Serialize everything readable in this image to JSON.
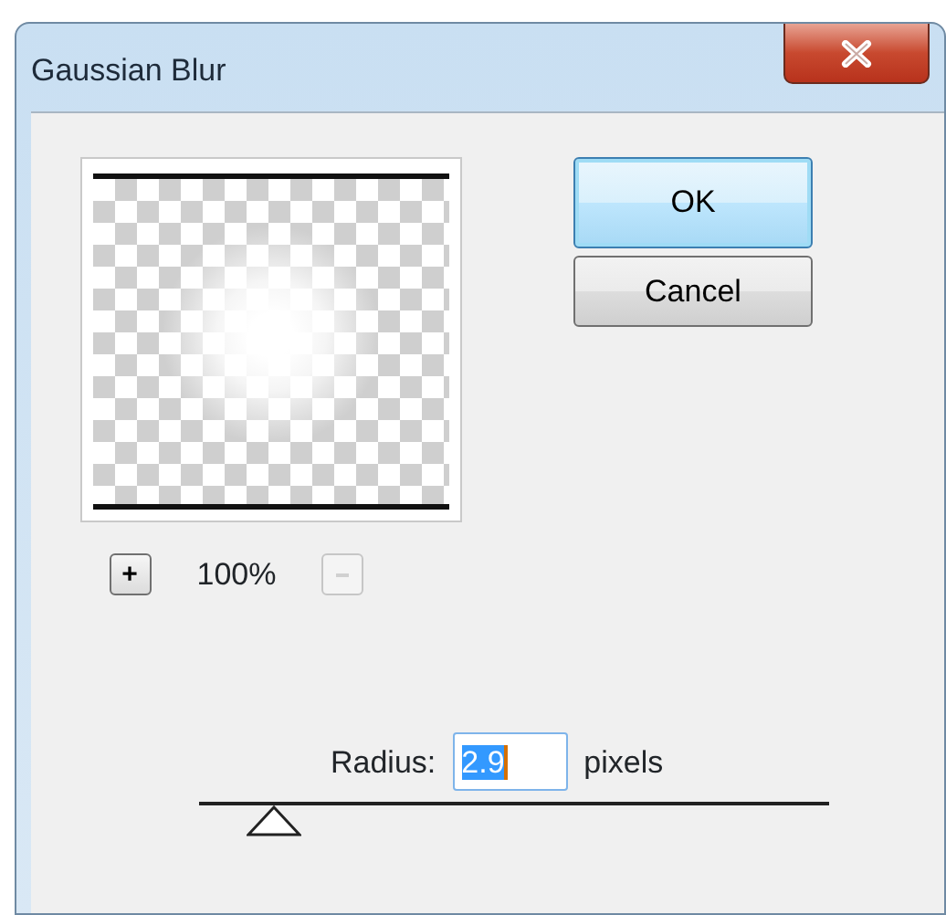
{
  "window": {
    "title": "Gaussian Blur"
  },
  "preview": {
    "zoom_level": "100%",
    "zoom_in": {
      "label": "+",
      "disabled": false
    },
    "zoom_out": {
      "disabled": true
    }
  },
  "buttons": [
    {
      "label": "OK",
      "default": true
    },
    {
      "label": "Cancel",
      "default": false
    }
  ],
  "radius": {
    "label": "Radius:",
    "value": "2.9",
    "value_selected": true,
    "unit": "pixels",
    "level": 0.12
  }
}
